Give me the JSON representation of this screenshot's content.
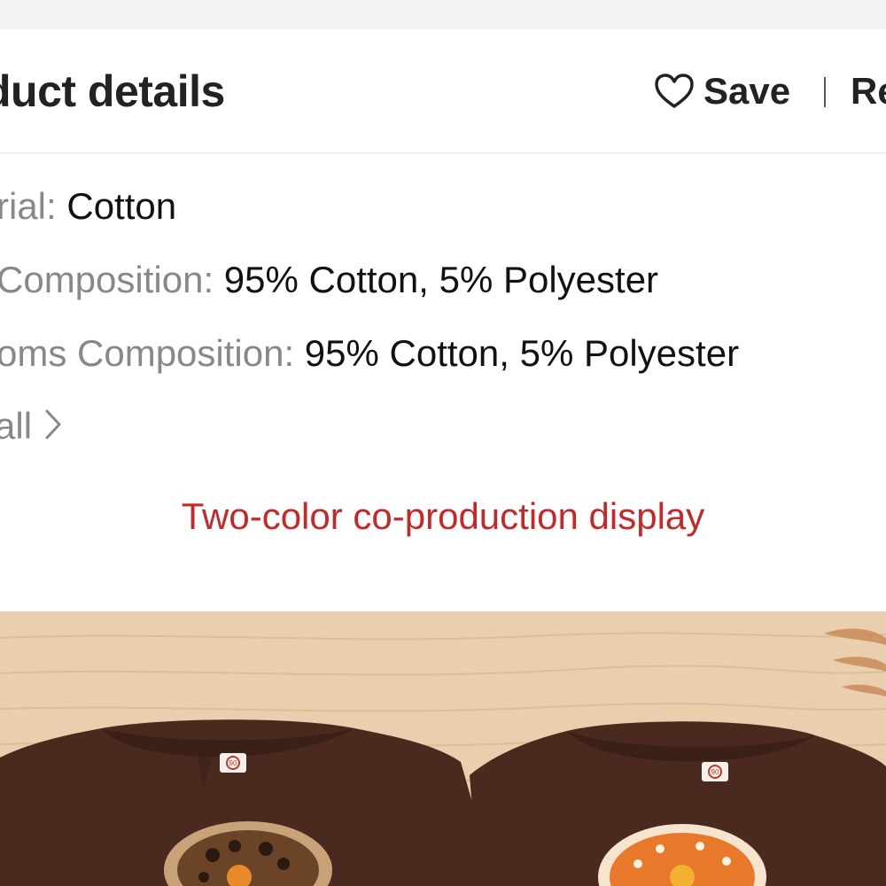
{
  "header": {
    "title": "duct details",
    "save_label": "Save",
    "report_label": "Re"
  },
  "details": [
    {
      "label": "rial: ",
      "value": "Cotton"
    },
    {
      "label": " Composition: ",
      "value": "95% Cotton, 5% Polyester"
    },
    {
      "label": "oms Composition: ",
      "value": "95% Cotton, 5% Polyester"
    }
  ],
  "view_all": {
    "label": "all"
  },
  "promo_text": "Two-color co-production display",
  "colors": {
    "promo_text": "#c62828",
    "label_gray": "#888888",
    "shirt_brown": "#4a2a1e",
    "wood": "#e9cfae"
  },
  "product_image": {
    "size_tag_left": "90",
    "size_tag_right": "90"
  }
}
